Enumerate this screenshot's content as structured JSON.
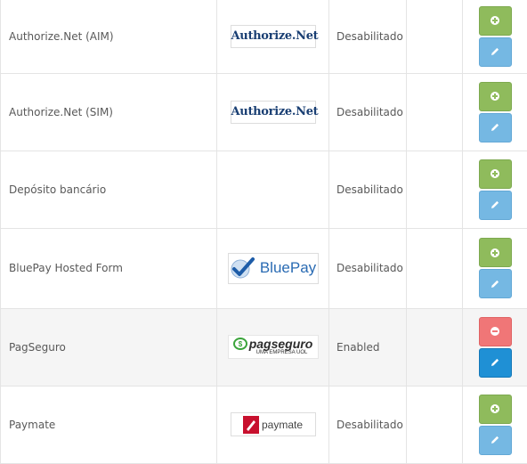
{
  "payments": {
    "rows": [
      {
        "name": "Authorize.Net (AIM)",
        "logo_text": "Authorize.Net",
        "status": "Desabilitado"
      },
      {
        "name": "Authorize.Net (SIM)",
        "logo_text": "Authorize.Net",
        "status": "Desabilitado"
      },
      {
        "name": "Depósito bancário",
        "logo_text": "",
        "status": "Desabilitado"
      },
      {
        "name": "BluePay Hosted Form",
        "logo_text": "BluePay",
        "status": "Desabilitado"
      },
      {
        "name": "PagSeguro",
        "logo_text": "pagseguro",
        "logo_subtext": "UMA EMPRESA UOL",
        "status": "Enabled"
      },
      {
        "name": "Paymate",
        "logo_text": "paymate",
        "status": "Desabilitado"
      }
    ]
  },
  "icons": {
    "install": "plus-circle-icon",
    "uninstall": "minus-circle-icon",
    "edit": "pencil-icon"
  },
  "colors": {
    "install_button": "#8fbb5c",
    "edit_button": "#75b8e3",
    "edit_button_active": "#1f90d5",
    "uninstall_button": "#f07677",
    "text": "#595959",
    "highlight_row": "#f5f5f5"
  }
}
